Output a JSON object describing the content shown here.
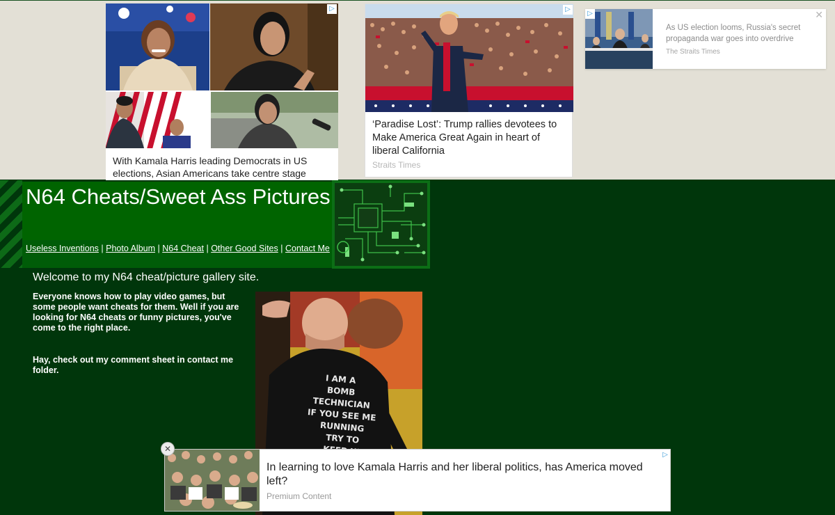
{
  "ads": {
    "card1": {
      "caption": "With Kamala Harris leading Democrats in US elections, Asian Americans take centre stage",
      "adchoice_icon": "adchoices-icon"
    },
    "card2": {
      "caption": "‘Paradise Lost’: Trump rallies devotees to Make America Great Again in heart of liberal California",
      "source": "Straits Times",
      "adchoice_icon": "adchoices-icon"
    },
    "card3": {
      "caption": "As US election looms, Russia's secret propaganda war goes into overdrive",
      "source": "The Straits Times",
      "close_label": "✕"
    },
    "bottom": {
      "caption": "In learning to love Kamala Harris and her liberal politics, has America moved left?",
      "source": "Premium Content",
      "close_label": "✕"
    }
  },
  "site": {
    "title": "N64 Cheats/Sweet Ass Pictures",
    "nav": [
      "Useless Inventions",
      "Photo Album",
      "N64 Cheat",
      "Other Good Sites",
      "Contact Me"
    ],
    "nav_separator": " | ",
    "welcome": "Welcome to my N64 cheat/picture gallery site.",
    "intro": "Everyone knows how to play video games, but some people want cheats for them. Well if you are looking for N64 cheats or funny pictures, you've come to the right place.",
    "comment_note": "Hay, check out my comment sheet in contact me folder.",
    "photo_shirt_text": [
      "I AM A",
      "BOMB",
      "TECHNICIAN",
      "IF YOU SEE ME",
      "RUNNING",
      "TRY TO",
      "KEEP UP"
    ]
  },
  "colors": {
    "page_bg": "#00360b",
    "header_bg": "#006400",
    "ad_strip_bg": "#e3e0d6",
    "adchoice_blue": "#3a9bd8"
  }
}
